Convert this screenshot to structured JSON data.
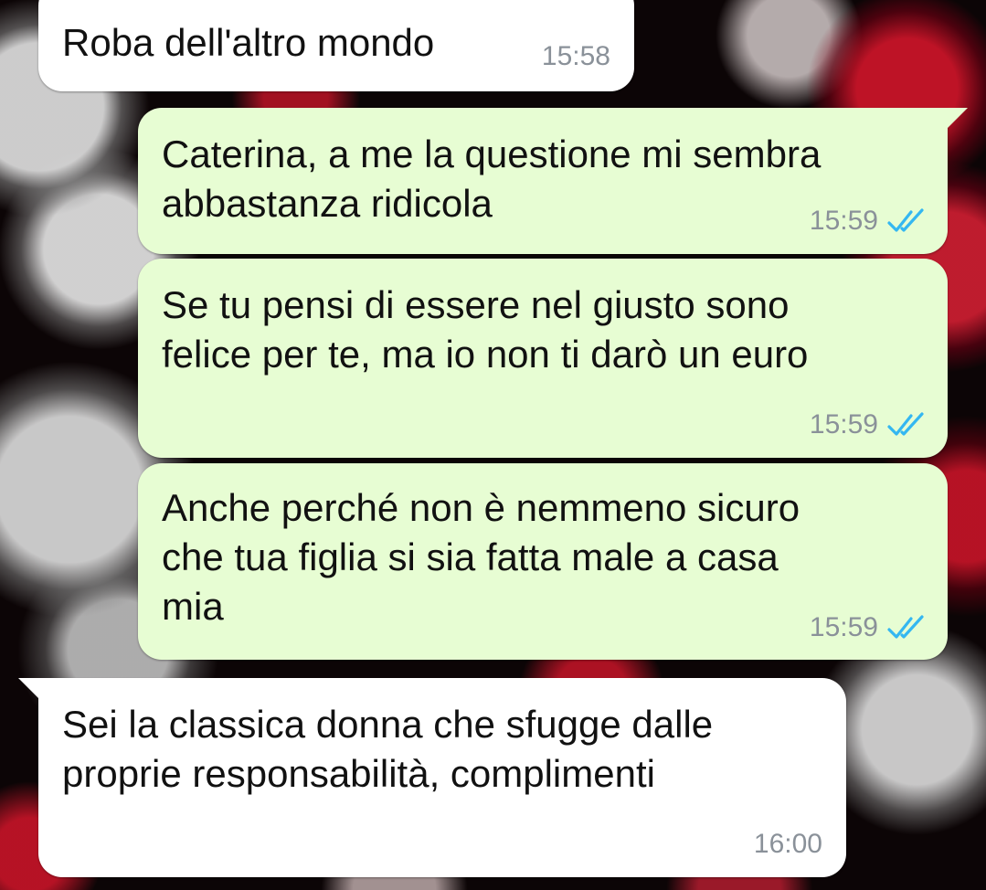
{
  "chat": {
    "messages": [
      {
        "direction": "incoming",
        "text": "Roba dell'altro mondo",
        "time": "15:58"
      },
      {
        "direction": "outgoing",
        "text": "Caterina, a me la questione mi sembra\nabbastanza ridicola",
        "time": "15:59",
        "status": "read"
      },
      {
        "direction": "outgoing",
        "text": "Se tu pensi di essere nel giusto sono\nfelice per te, ma io non ti darò un euro",
        "time": "15:59",
        "status": "read"
      },
      {
        "direction": "outgoing",
        "text": "Anche perché non è nemmeno sicuro\nche tua figlia si sia fatta male a casa\nmia",
        "time": "15:59",
        "status": "read"
      },
      {
        "direction": "incoming",
        "text": "Sei la classica donna che sfugge dalle\nproprie responsabilità, complimenti",
        "time": "16:00"
      }
    ]
  },
  "colors": {
    "outgoing_bubble": "#e7fdd3",
    "incoming_bubble": "#ffffff",
    "read_check": "#34b7f1",
    "timestamp": "#8a9199"
  },
  "icons": {
    "read_receipt": "double-check-icon"
  }
}
